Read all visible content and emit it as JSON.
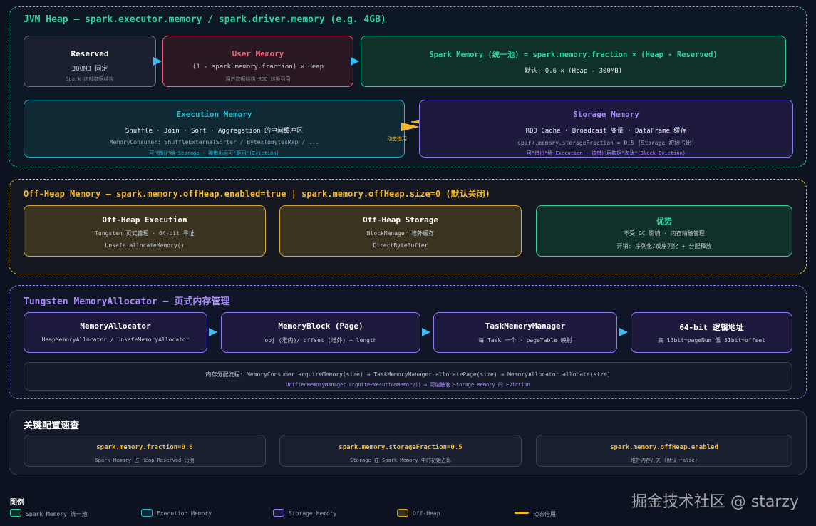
{
  "colors": {
    "background": "#0d1220",
    "jvm_border": "#2dd4a3",
    "offheap_border": "#f5b829",
    "tungsten_border": "#8b7cf6",
    "reserved": "#64748b",
    "user": "#f0607a",
    "spark": "#2dd4a3",
    "execution": "#22b8d4",
    "storage": "#8b7cf6",
    "arrow": "#38bdf8",
    "dynamic": "#f5b829"
  },
  "jvm": {
    "title": "JVM Heap — spark.executor.memory / spark.driver.memory (e.g. 4GB)",
    "reserved": {
      "title": "Reserved",
      "line1": "300MB 固定",
      "line2": "Spark 内部数据结构"
    },
    "user": {
      "title": "User Memory",
      "line1": "(1 - spark.memory.fraction) × Heap",
      "line2": "用户数据结构·RDD 转换引用"
    },
    "spark": {
      "title": "Spark Memory (统一池) = spark.memory.fraction × (Heap - Reserved)",
      "line1": "默认: 0.6 × (Heap - 300MB)"
    },
    "execution": {
      "title": "Execution Memory",
      "line1": "Shuffle · Join · Sort · Aggregation 的中间缓冲区",
      "line2": "MemoryConsumer: ShuffleExternalSorter / BytesToBytesMap / ...",
      "line3": "可\"借出\"给 Storage · 被借出后可\"驱回\"(Eviction)"
    },
    "dynamic_label": "动态借用",
    "storage": {
      "title": "Storage Memory",
      "line1": "RDD Cache · Broadcast 变量 · DataFrame 缓存",
      "line2": "spark.memory.storageFraction = 0.5 (Storage 初始占比)",
      "line3": "可\"借出\"给 Execution · 被借出后数据\"淘汰\"(Block Eviction)"
    }
  },
  "offheap": {
    "title": "Off-Heap Memory — spark.memory.offHeap.enabled=true | spark.memory.offHeap.size=0 (默认关闭)",
    "execution": {
      "title": "Off-Heap Execution",
      "line1": "Tungsten 页式管理 · 64-bit 寻址",
      "line2": "Unsafe.allocateMemory()"
    },
    "storage": {
      "title": "Off-Heap Storage",
      "line1": "BlockManager 堆外缓存",
      "line2": "DirectByteBuffer"
    },
    "advantage": {
      "title": "优势",
      "line1": "不受 GC 影响 · 内存精确管理",
      "line2": "开销: 序列化/反序列化 + 分配释放"
    }
  },
  "tungsten": {
    "title": "Tungsten MemoryAllocator — 页式内存管理",
    "allocator": {
      "title": "MemoryAllocator",
      "line1": "HeapMemoryAllocator / UnsafeMemoryAllocator"
    },
    "block": {
      "title": "MemoryBlock (Page)",
      "line1": "obj (堆内)/ offset (堆外) + length"
    },
    "task": {
      "title": "TaskMemoryManager",
      "line1": "每 Task 一个 · pageTable 映射"
    },
    "address": {
      "title": "64-bit 逻辑地址",
      "line1": "高 13bit=pageNum 低 51bit=offset"
    },
    "flow1": "内存分配流程: MemoryConsumer.acquireMemory(size) → TaskMemoryManager.allocatePage(size) → MemoryAllocator.allocate(size)",
    "flow2": "UnifiedMemoryManager.acquireExecutionMemory() → 可能触发 Storage Memory 的 Eviction"
  },
  "config": {
    "title": "关键配置速查",
    "items": [
      {
        "key": "spark.memory.fraction=0.6",
        "desc": "Spark Memory 占 Heap-Reserved 比例"
      },
      {
        "key": "spark.memory.storageFraction=0.5",
        "desc": "Storage 在 Spark Memory 中的初始占比"
      },
      {
        "key": "spark.memory.offHeap.enabled",
        "desc": "堆外内存开关 (默认 false)"
      }
    ]
  },
  "legend": {
    "title": "图例",
    "items": [
      {
        "label": "Spark Memory 统一池"
      },
      {
        "label": "Execution Memory"
      },
      {
        "label": "Storage Memory"
      },
      {
        "label": "Off-Heap"
      },
      {
        "label": "动态借用"
      }
    ]
  },
  "watermark": "掘金技术社区 @ starzy"
}
